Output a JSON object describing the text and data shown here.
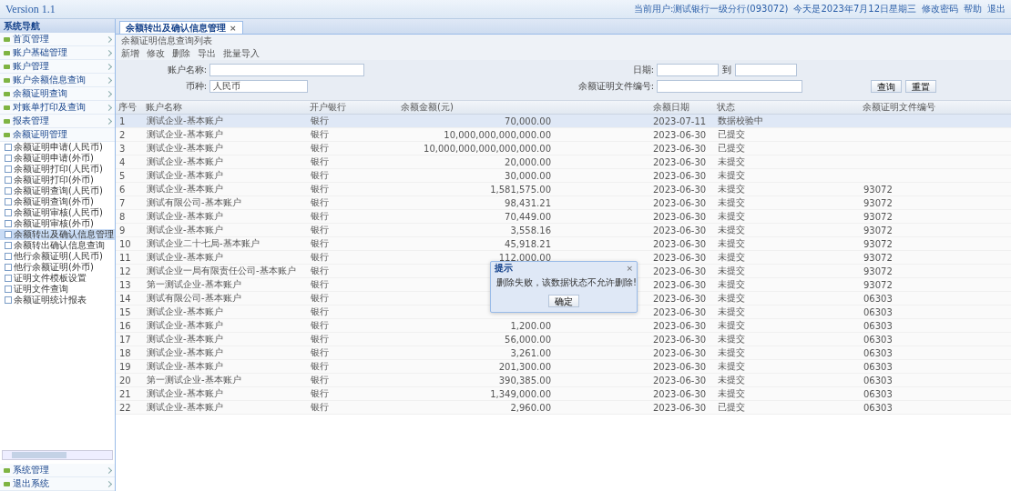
{
  "header": {
    "version": "Version 1.1",
    "links": [
      "当前用户:测试银行一级分行(093072)",
      "今天是2023年7月12日星期三",
      "修改密码",
      "帮助",
      "退出"
    ]
  },
  "sidebar": {
    "title": "系统导航",
    "groups": [
      {
        "label": "首页管理",
        "expanded": false
      },
      {
        "label": "账户基础管理",
        "expanded": false
      },
      {
        "label": "账户管理",
        "expanded": false
      },
      {
        "label": "账户余额信息查询",
        "expanded": false
      },
      {
        "label": "余额证明查询",
        "expanded": false
      },
      {
        "label": "对账单打印及查询",
        "expanded": false
      },
      {
        "label": "报表管理",
        "expanded": false
      },
      {
        "label": "余额证明管理",
        "expanded": true,
        "children": [
          {
            "label": "余额证明申请(人民币)",
            "selected": false
          },
          {
            "label": "余额证明申请(外币)",
            "selected": false
          },
          {
            "label": "余额证明打印(人民币)",
            "selected": false
          },
          {
            "label": "余额证明打印(外币)",
            "selected": false
          },
          {
            "label": "余额证明查询(人民币)",
            "selected": false
          },
          {
            "label": "余额证明查询(外币)",
            "selected": false
          },
          {
            "label": "余额证明审核(人民币)",
            "selected": false
          },
          {
            "label": "余额证明审核(外币)",
            "selected": false
          },
          {
            "label": "余额转出及确认信息管理",
            "selected": true
          },
          {
            "label": "余额转出确认信息查询",
            "selected": false
          },
          {
            "label": "他行余额证明(人民币)",
            "selected": false
          },
          {
            "label": "他行余额证明(外币)",
            "selected": false
          },
          {
            "label": "证明文件模板设置",
            "selected": false
          },
          {
            "label": "证明文件查询",
            "selected": false
          },
          {
            "label": "余额证明统计报表",
            "selected": false
          }
        ]
      }
    ],
    "bottom_groups": [
      "系统管理",
      "退出系统"
    ]
  },
  "tab": {
    "label": "余额转出及确认信息管理",
    "close": "×"
  },
  "panel_title": "余额证明信息查询列表",
  "toolbar": [
    "新增",
    "修改",
    "删除",
    "导出",
    "批量导入"
  ],
  "filters": {
    "account_label": "账户名称:",
    "date_label": "日期:",
    "date_sep": "到",
    "currency_label": "币种:",
    "currency_value": "人民币",
    "doc_label": "余额证明文件编号:",
    "buttons": [
      "查询",
      "重置"
    ]
  },
  "table": {
    "columns": [
      "序号",
      "账户名称",
      "开户银行",
      "余额金额(元)",
      "余额日期",
      "状态",
      "余额证明文件编号"
    ],
    "rows": [
      {
        "cells": [
          "1",
          "测试企业-基本账户",
          "银行",
          "70,000.00",
          "2023-07-11",
          "数据校验中",
          ""
        ],
        "selected": true
      },
      {
        "cells": [
          "2",
          "测试企业-基本账户",
          "银行",
          "10,000,000,000,000.00",
          "2023-06-30",
          "已提交",
          ""
        ],
        "selected": false
      },
      {
        "cells": [
          "3",
          "测试企业-基本账户",
          "银行",
          "10,000,000,000,000,000.00",
          "2023-06-30",
          "已提交",
          ""
        ],
        "selected": false
      },
      {
        "cells": [
          "4",
          "测试企业-基本账户",
          "银行",
          "20,000.00",
          "2023-06-30",
          "未提交",
          ""
        ],
        "selected": false
      },
      {
        "cells": [
          "5",
          "测试企业-基本账户",
          "银行",
          "30,000.00",
          "2023-06-30",
          "未提交",
          ""
        ],
        "selected": false
      },
      {
        "cells": [
          "6",
          "测试企业-基本账户",
          "银行",
          "1,581,575.00",
          "2023-06-30",
          "未提交",
          "93072"
        ],
        "selected": false
      },
      {
        "cells": [
          "7",
          "测试有限公司-基本账户",
          "银行",
          "98,431.21",
          "2023-06-30",
          "未提交",
          "93072"
        ],
        "selected": false
      },
      {
        "cells": [
          "8",
          "测试企业-基本账户",
          "银行",
          "70,449.00",
          "2023-06-30",
          "未提交",
          "93072"
        ],
        "selected": false
      },
      {
        "cells": [
          "9",
          "测试企业-基本账户",
          "银行",
          "3,558.16",
          "2023-06-30",
          "未提交",
          "93072"
        ],
        "selected": false
      },
      {
        "cells": [
          "10",
          "测试企业二十七局-基本账户",
          "银行",
          "45,918.21",
          "2023-06-30",
          "未提交",
          "93072"
        ],
        "selected": false
      },
      {
        "cells": [
          "11",
          "测试企业-基本账户",
          "银行",
          "112,000.00",
          "2023-06-30",
          "未提交",
          "93072"
        ],
        "selected": false
      },
      {
        "cells": [
          "12",
          "测试企业一局有限责任公司-基本账户",
          "银行",
          "",
          "2023-06-30",
          "未提交",
          "93072"
        ],
        "selected": false
      },
      {
        "cells": [
          "13",
          "第一测试企业-基本账户",
          "银行",
          "",
          "2023-06-30",
          "未提交",
          "93072"
        ],
        "selected": false
      },
      {
        "cells": [
          "14",
          "测试有限公司-基本账户",
          "银行",
          "",
          "2023-06-30",
          "未提交",
          "06303"
        ],
        "selected": false
      },
      {
        "cells": [
          "15",
          "测试企业-基本账户",
          "银行",
          "",
          "2023-06-30",
          "未提交",
          "06303"
        ],
        "selected": false
      },
      {
        "cells": [
          "16",
          "测试企业-基本账户",
          "银行",
          "1,200.00",
          "2023-06-30",
          "未提交",
          "06303"
        ],
        "selected": false
      },
      {
        "cells": [
          "17",
          "测试企业-基本账户",
          "银行",
          "56,000.00",
          "2023-06-30",
          "未提交",
          "06303"
        ],
        "selected": false
      },
      {
        "cells": [
          "18",
          "测试企业-基本账户",
          "银行",
          "3,261.00",
          "2023-06-30",
          "未提交",
          "06303"
        ],
        "selected": false
      },
      {
        "cells": [
          "19",
          "测试企业-基本账户",
          "银行",
          "201,300.00",
          "2023-06-30",
          "未提交",
          "06303"
        ],
        "selected": false
      },
      {
        "cells": [
          "20",
          "第一测试企业-基本账户",
          "银行",
          "390,385.00",
          "2023-06-30",
          "未提交",
          "06303"
        ],
        "selected": false
      },
      {
        "cells": [
          "21",
          "测试企业-基本账户",
          "银行",
          "1,349,000.00",
          "2023-06-30",
          "未提交",
          "06303"
        ],
        "selected": false
      },
      {
        "cells": [
          "22",
          "测试企业-基本账户",
          "银行",
          "2,960.00",
          "2023-06-30",
          "已提交",
          "06303"
        ],
        "selected": false
      }
    ]
  },
  "dialog": {
    "title": "提示",
    "close": "×",
    "message": "删除失败，该数据状态不允许删除!",
    "button": "确定"
  }
}
